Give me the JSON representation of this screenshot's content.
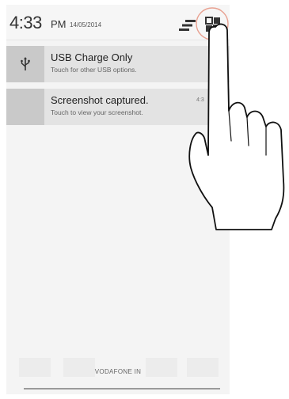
{
  "status_bar": {
    "time": "4:33",
    "ampm": "PM",
    "date": "14/05/2014",
    "sort_icon": "notification-sort-icon",
    "quick_settings_icon": "quick-settings-icon"
  },
  "notifications": [
    {
      "icon": "usb-icon",
      "title": "USB Charge Only",
      "subtitle": "Touch for other USB options."
    },
    {
      "icon": "screenshot-thumbnail",
      "title": "Screenshot captured.",
      "subtitle": "Touch to view your screenshot.",
      "time": "4:3"
    }
  ],
  "footer": {
    "carrier": "VODAFONE IN"
  },
  "overlay": {
    "hand": "pointing-hand-icon",
    "highlight_color": "#e8a090"
  },
  "colors": {
    "panel_bg": "#f4f4f4",
    "notification_bg": "#e3e3e3",
    "icon_box_bg": "#c9c9c9"
  }
}
